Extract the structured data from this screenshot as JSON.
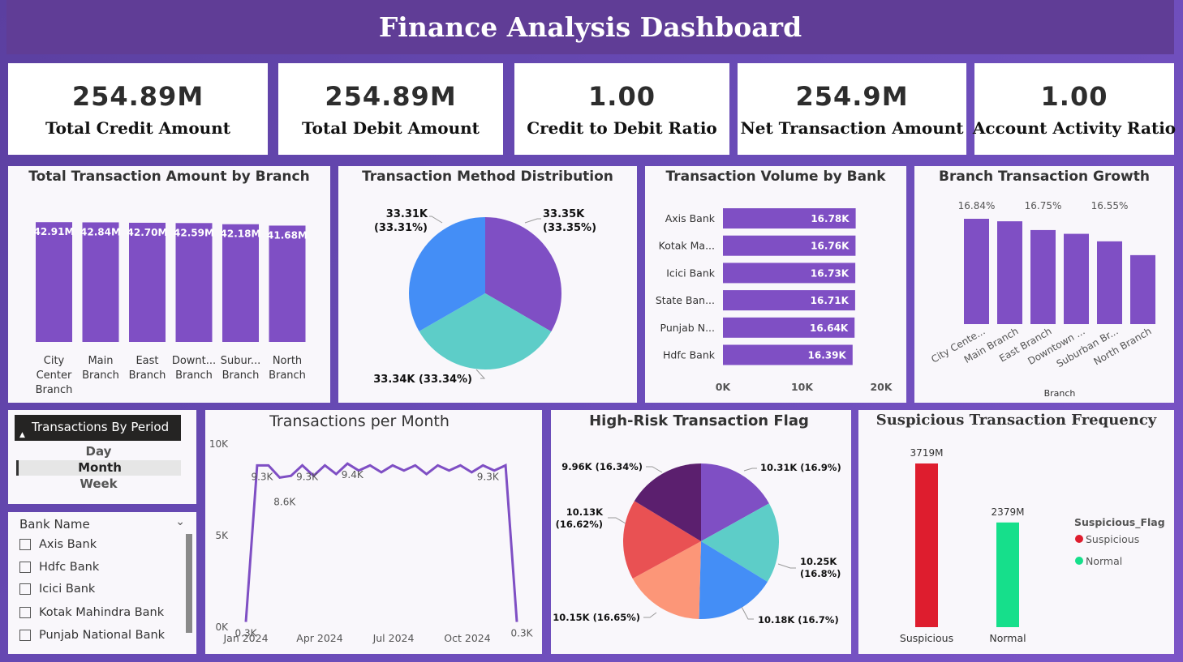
{
  "header": {
    "title": "Finance Analysis Dashboard"
  },
  "kpis": [
    {
      "value": "254.89M",
      "label": "Total Credit Amount"
    },
    {
      "value": "254.89M",
      "label": "Total Debit Amount"
    },
    {
      "value": "1.00",
      "label": "Credit to Debit Ratio"
    },
    {
      "value": "254.9M",
      "label": "Net Transaction Amount"
    },
    {
      "value": "1.00",
      "label": "Account Activity Ratio"
    }
  ],
  "slicer_period": {
    "title": "Transactions By Period",
    "options": [
      "Day",
      "Month",
      "Week"
    ],
    "selected": "Month"
  },
  "slicer_bank": {
    "title": "Bank Name",
    "options": [
      "Axis Bank",
      "Hdfc Bank",
      "Icici Bank",
      "Kotak Mahindra Bank",
      "Punjab National Bank"
    ]
  },
  "colors": {
    "purple": "#7f4fc4",
    "blue": "#448ef6",
    "teal": "#5dcdc8",
    "red": "#de1d2e",
    "green": "#16df8b",
    "salmon": "#fc9678",
    "coral": "#e95153",
    "darkpurple": "#5b1f6e"
  },
  "chart_data": [
    {
      "id": "branch_amount",
      "type": "bar",
      "title": "Total Transaction Amount by Branch",
      "categories": [
        "City Center Branch",
        "Main Branch",
        "East Branch",
        "Downt... Branch",
        "Subur... Branch",
        "North Branch"
      ],
      "category_lines": [
        [
          "City",
          "Center",
          "Branch"
        ],
        [
          "Main",
          "Branch"
        ],
        [
          "East",
          "Branch"
        ],
        [
          "Downt...",
          "Branch"
        ],
        [
          "Subur...",
          "Branch"
        ],
        [
          "North",
          "Branch"
        ]
      ],
      "values": [
        42.91,
        42.84,
        42.7,
        42.59,
        42.18,
        41.68
      ],
      "labels": [
        "42.91M",
        "42.84M",
        "42.70M",
        "42.59M",
        "42.18M",
        "41.68M"
      ],
      "ylim": [
        0,
        45
      ]
    },
    {
      "id": "method_dist",
      "type": "pie",
      "title": "Transaction Method Distribution",
      "values": [
        33.35,
        33.34,
        33.31
      ],
      "labels": [
        [
          "33.35K",
          "(33.35%)"
        ],
        [
          "33.34K (33.34%)"
        ],
        [
          "33.31K",
          "(33.31%)"
        ]
      ]
    },
    {
      "id": "bank_volume",
      "type": "bar",
      "orientation": "horizontal",
      "title": "Transaction Volume by Bank",
      "categories": [
        "Axis Bank",
        "Kotak Ma...",
        "Icici Bank",
        "State Ban...",
        "Punjab N...",
        "Hdfc Bank"
      ],
      "values": [
        16.78,
        16.76,
        16.73,
        16.71,
        16.64,
        16.39
      ],
      "labels": [
        "16.78K",
        "16.76K",
        "16.73K",
        "16.71K",
        "16.64K",
        "16.39K"
      ],
      "xticks": [
        "0K",
        "10K",
        "20K"
      ],
      "xlim": [
        0,
        20
      ]
    },
    {
      "id": "branch_growth",
      "type": "bar",
      "title": "Branch Transaction Growth",
      "xlabel": "Branch",
      "categories": [
        "City Cente...",
        "Main Branch",
        "East Branch",
        "Downtown ...",
        "Suburban Br...",
        "North Branch"
      ],
      "values": [
        16.84,
        16.82,
        16.75,
        16.72,
        16.66,
        16.55
      ],
      "labels": [
        "16.84%",
        "",
        "16.75%",
        "",
        "16.55%",
        ""
      ],
      "ylim": [
        0,
        16.84
      ]
    },
    {
      "id": "tx_per_month",
      "type": "line",
      "title": "Transactions per Month",
      "yticks": [
        "10K",
        "5K",
        "0K"
      ],
      "ylim": [
        0,
        10000
      ],
      "xticks": [
        "Jan 2024",
        "Apr 2024",
        "Jul 2024",
        "Oct 2024"
      ],
      "values": [
        300,
        9300,
        9300,
        8600,
        8700,
        9300,
        8700,
        9300,
        8800,
        9400,
        9000,
        9300,
        8900,
        9300,
        9000,
        9300,
        8800,
        9300,
        9000,
        9300,
        8900,
        9300,
        9000,
        9300,
        300
      ],
      "point_labels": [
        {
          "i": 0,
          "text": "0.3K"
        },
        {
          "i": 1,
          "text": "9.3K"
        },
        {
          "i": 3,
          "text": "8.6K"
        },
        {
          "i": 5,
          "text": "9.3K"
        },
        {
          "i": 9,
          "text": "9.4K"
        },
        {
          "i": 21,
          "text": "9.3K"
        },
        {
          "i": 24,
          "text": "0.3K"
        }
      ]
    },
    {
      "id": "high_risk",
      "type": "pie",
      "title": "High-Risk Transaction Flag",
      "values": [
        10.31,
        10.25,
        10.18,
        10.15,
        10.13,
        9.96
      ],
      "labels": [
        [
          "10.31K (16.9%)"
        ],
        [
          "10.25K",
          "(16.8%)"
        ],
        [
          "10.18K (16.7%)"
        ],
        [
          "10.15K (16.65%)"
        ],
        [
          "10.13K",
          "(16.62%)"
        ],
        [
          "9.96K (16.34%)"
        ]
      ]
    },
    {
      "id": "suspicious",
      "type": "bar",
      "title": "Suspicious Transaction Frequency",
      "categories": [
        "Suspicious",
        "Normal"
      ],
      "values": [
        3719,
        2379
      ],
      "labels": [
        "3719M",
        "2379M"
      ],
      "ylim": [
        0,
        3719
      ],
      "legend": {
        "title": "Suspicious_Flag",
        "items": [
          "Suspicious",
          "Normal"
        ]
      }
    }
  ]
}
